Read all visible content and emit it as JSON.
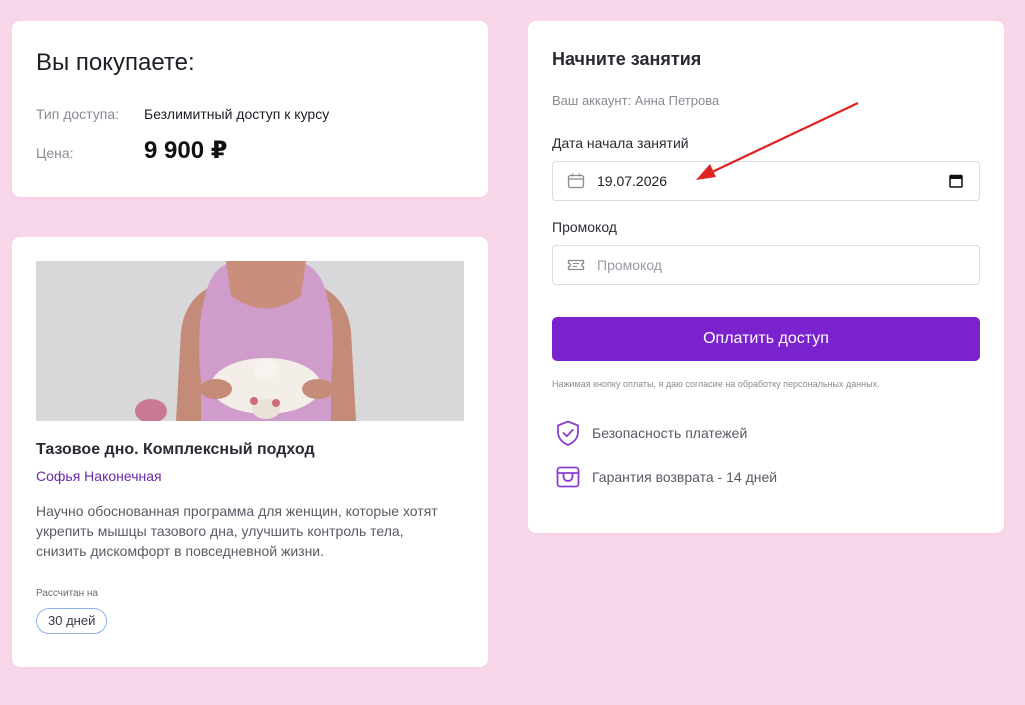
{
  "summary": {
    "title": "Вы покупаете:",
    "access_label": "Тип доступа:",
    "access_value": "Безлимитный доступ к курсу",
    "price_label": "Цена:",
    "price_value": "9 900 ₽"
  },
  "course": {
    "title": "Тазовое дно. Комплексный подход",
    "author": "Софья Наконечная",
    "description": "Научно обоснованная программа для женщин, которые хотят укрепить мышцы тазового дна, улучшить контроль тела, снизить дискомфорт в повседневной жизни.",
    "duration_label": "Рассчитан на",
    "duration_value": "30 дней"
  },
  "checkout": {
    "title": "Начните занятия",
    "account": "Ваш аккаунт: Анна Петрова",
    "date_label": "Дата начала занятий",
    "date_value": "19.07.2026",
    "promo_label": "Промокод",
    "promo_placeholder": "Промокод",
    "pay_button": "Оплатить доступ",
    "consent": "Нажимая кнопку оплаты, я даю согласие на обработку персональных данных.",
    "features": [
      {
        "icon": "shield-check-icon",
        "label": "Безопасность платежей"
      },
      {
        "icon": "refund-box-icon",
        "label": "Гарантия возврата - 14 дней"
      }
    ]
  },
  "colors": {
    "background": "#f9d7ea",
    "accent": "#7b22cf",
    "author": "#6a2aa8",
    "annotation_arrow": "#e02424"
  }
}
